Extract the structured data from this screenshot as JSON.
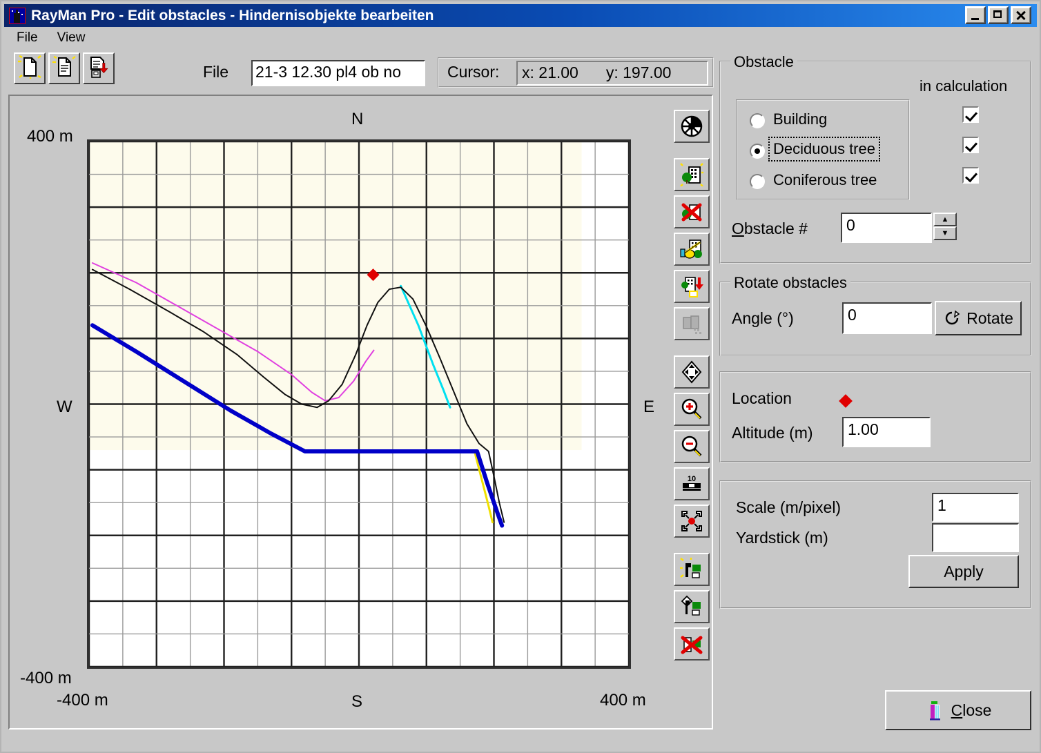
{
  "window": {
    "title": "RayMan Pro - Edit obstacles - Hindernisobjekte bearbeiten",
    "minimize": "_",
    "maximize": "□",
    "close": "×"
  },
  "menu": {
    "items": [
      "File",
      "View"
    ]
  },
  "toolbar": {
    "buttons": [
      "new-file-icon",
      "open-file-icon",
      "save-file-icon"
    ],
    "file_label": "File",
    "file_value": "21-3   12.30 pl4 ob no",
    "cursor_label": "Cursor:",
    "cursor_x": "x: 21.00",
    "cursor_y": "y: 197.00"
  },
  "vtools": [
    "compass-icon",
    "add-building-icon",
    "delete-building-icon",
    "edit-building-icon",
    "import-building-icon",
    "copy-building-icon",
    "pan-icon",
    "zoom-in-icon",
    "zoom-out-icon",
    "yardstick-icon",
    "center-icon",
    "add-area-icon",
    "move-area-icon",
    "delete-area-icon"
  ],
  "chart_labels": {
    "north": "N",
    "west": "W",
    "east": "E",
    "south": "S",
    "top_left": "400 m",
    "bottom_left": "-400 m",
    "x_left": "-400 m",
    "x_right": "400 m"
  },
  "obstacle": {
    "group_title": "Obstacle",
    "in_calculation_label": "in calculation",
    "types": [
      {
        "label": "Building",
        "selected": false,
        "in_calculation": true
      },
      {
        "label": "Deciduous tree",
        "selected": true,
        "in_calculation": true
      },
      {
        "label": "Coniferous tree",
        "selected": false,
        "in_calculation": true
      }
    ],
    "number_label": "Obstacle #",
    "number_value": "0"
  },
  "rotate": {
    "group_title": "Rotate obstacles",
    "angle_label": "Angle (°)",
    "angle_value": "0",
    "button_label": "Rotate"
  },
  "location": {
    "label": "Location",
    "marker_color": "#e00000",
    "altitude_label": "Altitude (m)",
    "altitude_value": "1.00"
  },
  "scale": {
    "scale_label": "Scale (m/pixel)",
    "scale_value": "1",
    "yardstick_label": "Yardstick (m)",
    "yardstick_value": "",
    "apply_label": "Apply"
  },
  "footer": {
    "close_label": "Close"
  },
  "chart_data": {
    "type": "line",
    "title": "",
    "xlabel": "S",
    "ylabel": "W",
    "xlim": [
      -400,
      400
    ],
    "ylim": [
      -400,
      400
    ],
    "grid": true,
    "major_gridline_step_m": 100,
    "minor_gridline_step_m": 50,
    "plot_background": "#fdfbec",
    "outside_background": "#ffffff",
    "shaded_region": {
      "x": [
        -400,
        330
      ],
      "y": [
        -70,
        400
      ],
      "color": "#fdfbec"
    },
    "marker": {
      "name": "location-marker",
      "x": 21,
      "y": 197,
      "color": "#e00000",
      "shape": "diamond"
    },
    "series": [
      {
        "name": "horizon-black",
        "color": "#101010",
        "width": 2,
        "points_m": [
          [
            -395,
            205
          ],
          [
            -340,
            175
          ],
          [
            -280,
            140
          ],
          [
            -230,
            110
          ],
          [
            -180,
            75
          ],
          [
            -140,
            40
          ],
          [
            -110,
            15
          ],
          [
            -85,
            0
          ],
          [
            -62,
            -5
          ],
          [
            -45,
            5
          ],
          [
            -25,
            30
          ],
          [
            -5,
            75
          ],
          [
            12,
            120
          ],
          [
            28,
            155
          ],
          [
            45,
            175
          ],
          [
            62,
            178
          ],
          [
            80,
            160
          ],
          [
            100,
            118
          ],
          [
            120,
            70
          ],
          [
            140,
            20
          ],
          [
            160,
            -30
          ],
          [
            178,
            -60
          ],
          [
            192,
            -72
          ],
          [
            200,
            -110
          ],
          [
            208,
            -150
          ],
          [
            215,
            -180
          ]
        ]
      },
      {
        "name": "horizon-magenta",
        "color": "#e040e0",
        "width": 2,
        "points_m": [
          [
            -395,
            215
          ],
          [
            -330,
            185
          ],
          [
            -270,
            150
          ],
          [
            -210,
            115
          ],
          [
            -150,
            80
          ],
          [
            -100,
            45
          ],
          [
            -70,
            18
          ],
          [
            -50,
            5
          ],
          [
            -30,
            10
          ],
          [
            -8,
            35
          ],
          [
            10,
            65
          ],
          [
            22,
            82
          ]
        ]
      },
      {
        "name": "horizon-blue",
        "color": "#0000c8",
        "width": 6,
        "points_m": [
          [
            -395,
            120
          ],
          [
            -330,
            80
          ],
          [
            -260,
            35
          ],
          [
            -190,
            -10
          ],
          [
            -130,
            -45
          ],
          [
            -80,
            -72
          ],
          [
            -30,
            -72
          ],
          [
            40,
            -72
          ],
          [
            110,
            -72
          ],
          [
            168,
            -72
          ],
          [
            175,
            -72
          ],
          [
            190,
            -120
          ],
          [
            205,
            -165
          ],
          [
            212,
            -185
          ]
        ]
      },
      {
        "name": "horizon-cyan",
        "color": "#00e0f0",
        "width": 3,
        "points_m": [
          [
            62,
            180
          ],
          [
            88,
            120
          ],
          [
            110,
            60
          ],
          [
            125,
            22
          ],
          [
            135,
            -5
          ]
        ]
      },
      {
        "name": "horizon-yellow",
        "color": "#f0e000",
        "width": 3,
        "points_m": [
          [
            172,
            -75
          ],
          [
            182,
            -115
          ],
          [
            192,
            -155
          ],
          [
            198,
            -180
          ]
        ]
      }
    ]
  }
}
